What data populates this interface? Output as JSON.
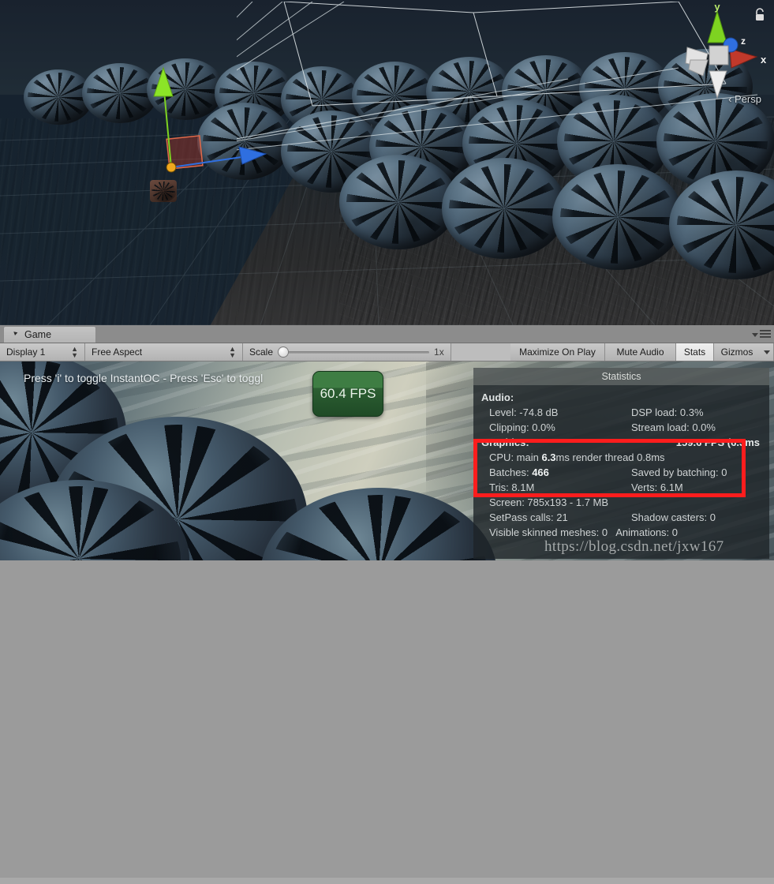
{
  "scene_view": {
    "gizmo": {
      "axis_x_label": "x",
      "axis_y_label": "y",
      "axis_z_label": "z",
      "projection_label": "Persp",
      "lock_icon": "lock-icon"
    },
    "background_color": "#1d2735",
    "grid_color": "#9fb3bd",
    "move_gizmo": {
      "up_axis_color": "#7ed321",
      "forward_axis_color": "#2f6fe0",
      "plane_handle_color": "#c0392b"
    }
  },
  "panel": {
    "tab": {
      "label": "Game",
      "icon": "unity-game-icon"
    },
    "window_menu_icon": "hamburger-menu-icon",
    "window_menu_caret_icon": "chevron-down-icon"
  },
  "toolbar": {
    "display_dropdown": {
      "label": "Display 1",
      "icon": "updown-arrows-icon"
    },
    "aspect_dropdown": {
      "label": "Free Aspect",
      "icon": "updown-arrows-icon"
    },
    "scale": {
      "label": "Scale",
      "value": "1x",
      "position_percent": 0
    },
    "maximize_on_play": "Maximize On Play",
    "mute_audio": "Mute Audio",
    "stats": "Stats",
    "gizmos": "Gizmos",
    "gizmos_caret_icon": "chevron-down-icon"
  },
  "game_view": {
    "hint_text": "Press 'i' to toggle InstantOC - Press 'Esc' to toggl",
    "fps_badge": {
      "value": "60.4 FPS",
      "color": "#3e7d43"
    }
  },
  "statistics": {
    "title": "Statistics",
    "audio": {
      "heading": "Audio:",
      "level": "Level: -74.8 dB",
      "dsp_load": "DSP load: 0.3%",
      "clipping": "Clipping: 0.0%",
      "stream_load": "Stream load: 0.0%"
    },
    "graphics": {
      "heading": "Graphics:",
      "fps": "159.6 FPS (6.3ms",
      "cpu_prefix": "CPU: main ",
      "cpu_main_value": "6.3",
      "cpu_suffix": "ms  render thread 0.8ms",
      "batches_label": "Batches: ",
      "batches_value": "466",
      "saved_by_batching": "Saved by batching: 0",
      "tris": "Tris: 8.1M",
      "verts": "Verts: 6.1M",
      "screen": "Screen: 785x193 - 1.7 MB",
      "setpass_calls": "SetPass calls: 21",
      "shadow_casters": "Shadow casters: 0",
      "visible_skinned_meshes": "Visible skinned meshes: 0",
      "animations": "Animations: 0"
    },
    "highlight_color": "#fd1d1d"
  },
  "watermark": {
    "text": "https://blog.csdn.net/jxw167"
  }
}
